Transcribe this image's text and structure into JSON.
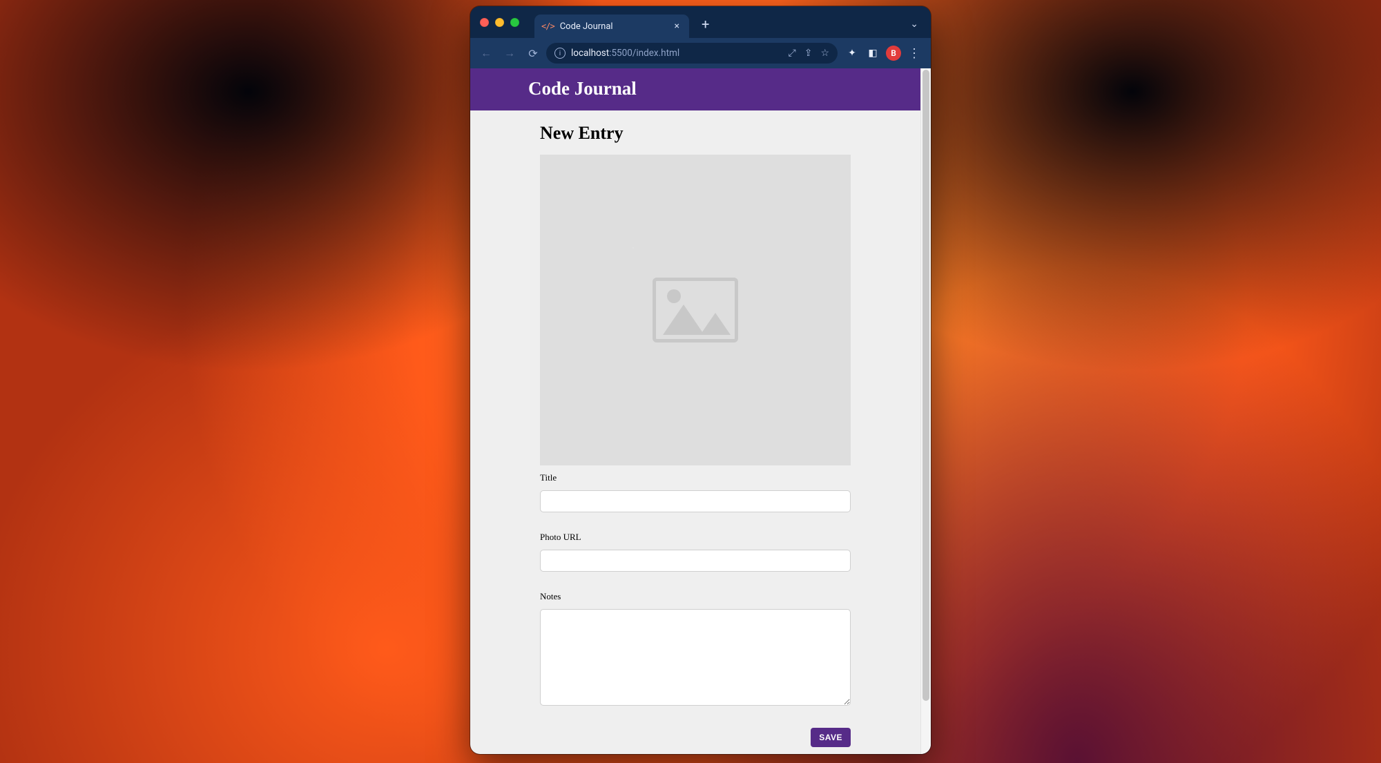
{
  "browser": {
    "tab": {
      "title": "Code Journal",
      "favicon_glyph": "</>"
    },
    "url": {
      "host": "localhost",
      "port": ":5500",
      "path": "/index.html"
    },
    "profile_badge": "B"
  },
  "app": {
    "header_title": "Code Journal",
    "page_heading": "New Entry",
    "fields": {
      "title": {
        "label": "Title",
        "value": ""
      },
      "photo_url": {
        "label": "Photo URL",
        "value": ""
      },
      "notes": {
        "label": "Notes",
        "value": ""
      }
    },
    "save_label": "SAVE"
  },
  "colors": {
    "brand_purple": "#562b88",
    "chrome_dark": "#0f2747",
    "chrome_light": "#1c3a63"
  }
}
